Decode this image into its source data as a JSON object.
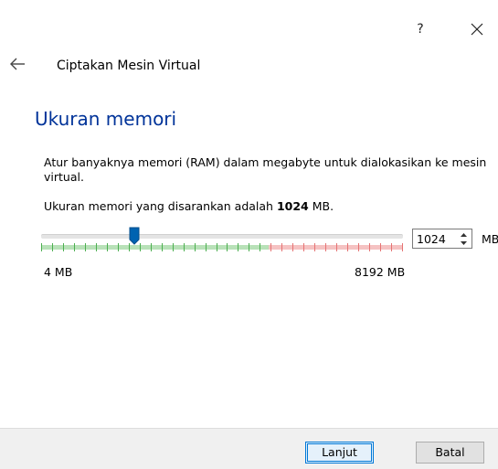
{
  "window": {
    "help_label": "?",
    "close_icon": "close-icon"
  },
  "header": {
    "back_icon": "arrow-left-icon",
    "title": "Ciptakan Mesin Virtual"
  },
  "main": {
    "heading": "Ukuran memori",
    "description": "Atur banyaknya memori (RAM) dalam megabyte untuk dialokasikan ke mesin virtual.",
    "recommend_prefix": "Ukuran memori yang disarankan adalah ",
    "recommend_value": "1024",
    "recommend_suffix": " MB.",
    "slider": {
      "value": 1024,
      "min": 4,
      "max": 8192,
      "green_fraction": 0.63,
      "colors": {
        "green": "#7ec97e",
        "red": "#ef9a9a",
        "handle": "#0063b1"
      }
    },
    "min_label": "4 MB",
    "max_label": "8192 MB",
    "spinbox_value": "1024",
    "unit": "MB"
  },
  "footer": {
    "next_label": "Lanjut",
    "cancel_label": "Batal"
  }
}
